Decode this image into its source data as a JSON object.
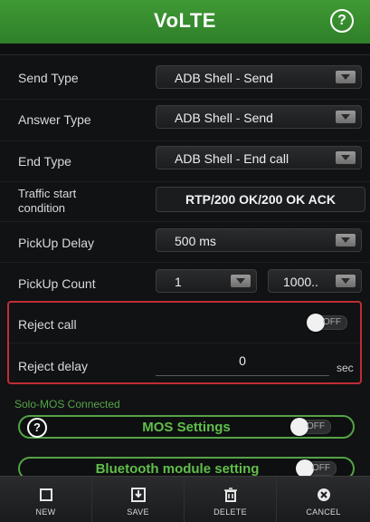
{
  "header": {
    "title": "VoLTE",
    "help_icon": "?"
  },
  "rows": {
    "send_type": {
      "label": "Send Type",
      "value": "ADB Shell - Send"
    },
    "answer_type": {
      "label": "Answer Type",
      "value": "ADB Shell - Send"
    },
    "end_type": {
      "label": "End Type",
      "value": "ADB Shell - End call"
    },
    "traffic": {
      "label_line1": "Traffic start",
      "label_line2": "condition",
      "value": "RTP/200 OK/200 OK ACK"
    },
    "pickup_delay": {
      "label": "PickUp Delay",
      "value": "500 ms"
    },
    "pickup_count": {
      "label": "PickUp Count",
      "value1": "1",
      "value2": "1000.."
    },
    "reject_call": {
      "label": "Reject call",
      "toggle": "OFF"
    },
    "reject_delay": {
      "label": "Reject delay",
      "value": "0",
      "unit": "sec"
    }
  },
  "solo_mos": {
    "label": "Solo-MOS Connected"
  },
  "mos_settings": {
    "label": "MOS Settings",
    "toggle": "OFF",
    "help": "?"
  },
  "bluetooth": {
    "label": "Bluetooth module setting",
    "toggle": "OFF"
  },
  "toolbar": [
    {
      "label": "NEW",
      "icon": "new-icon"
    },
    {
      "label": "SAVE",
      "icon": "save-icon"
    },
    {
      "label": "DELETE",
      "icon": "trash-icon"
    },
    {
      "label": "CANCEL",
      "icon": "cancel-icon"
    }
  ],
  "colors": {
    "accent": "#3f9a34",
    "highlight_border": "#c02d35",
    "green_text": "#5fbf4a"
  }
}
